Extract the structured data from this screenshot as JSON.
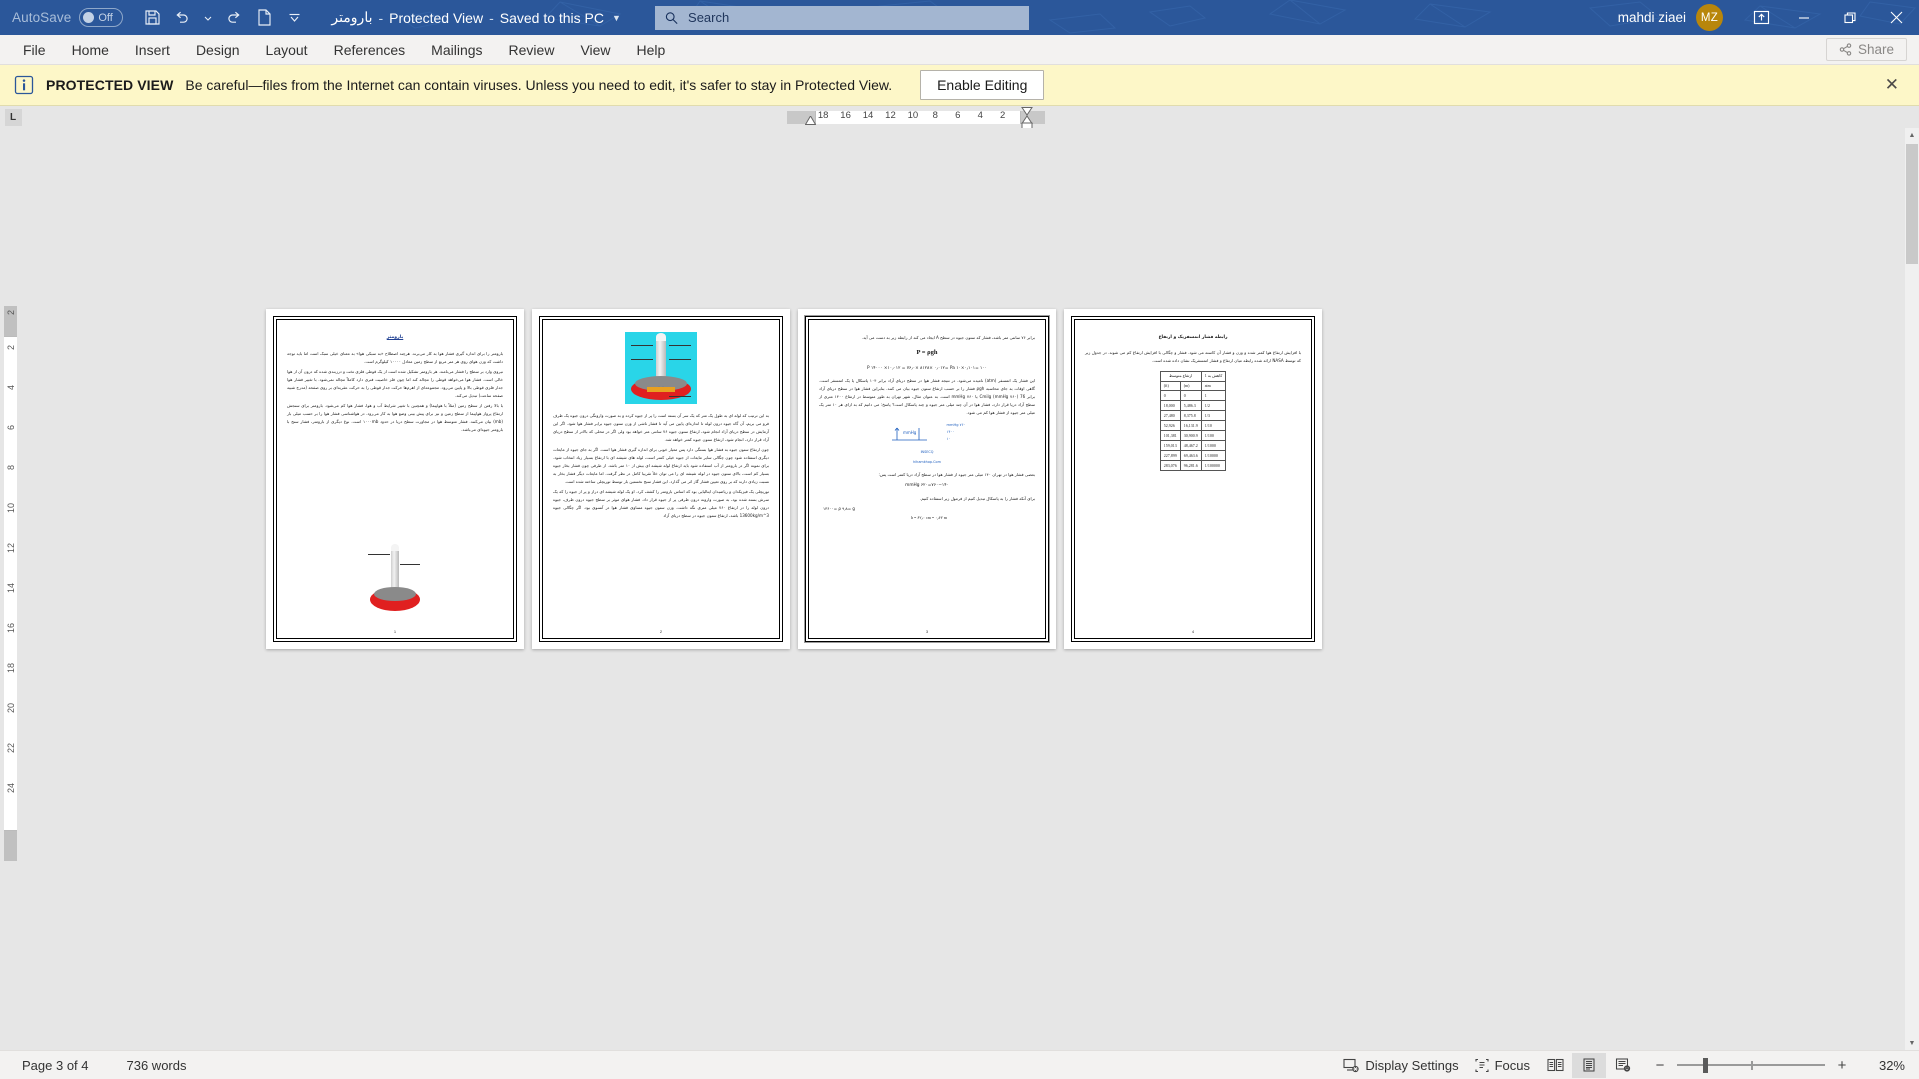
{
  "titlebar": {
    "autosave_label": "AutoSave",
    "autosave_state": "Off",
    "doc_title": "بارومتر",
    "sep1": "-",
    "protected_view": "Protected View",
    "sep2": "-",
    "saved_state": "Saved to this PC",
    "save_icon": "save-icon",
    "undo_icon": "undo-icon",
    "redo_icon": "redo-icon",
    "new_icon": "new-document-icon",
    "customize_icon": "customize-quick-access-icon",
    "username": "mahdi ziaei",
    "avatar_initials": "MZ",
    "ribbon_display_icon": "ribbon-display-options-icon",
    "minimize_icon": "minimize-icon",
    "restore_icon": "restore-icon",
    "close_icon": "close-icon",
    "accent_color": "#2b579a",
    "avatar_color": "#b8860b"
  },
  "search": {
    "placeholder": "Search",
    "value": "",
    "icon": "search-icon"
  },
  "menubar": {
    "items": [
      {
        "label": "File"
      },
      {
        "label": "Home"
      },
      {
        "label": "Insert"
      },
      {
        "label": "Design"
      },
      {
        "label": "Layout"
      },
      {
        "label": "References"
      },
      {
        "label": "Mailings"
      },
      {
        "label": "Review"
      },
      {
        "label": "View"
      },
      {
        "label": "Help"
      }
    ],
    "share_label": "Share",
    "share_icon": "share-icon"
  },
  "protected_view": {
    "icon": "info-icon",
    "strong": "PROTECTED VIEW",
    "message": "Be careful—files from the Internet can contain viruses. Unless you need to edit, it's safer to stay in Protected View.",
    "enable_button": "Enable Editing",
    "close_icon": "close-icon",
    "background": "#fdf7c8"
  },
  "rulers": {
    "tab_selector": "L",
    "horizontal_marks": [
      "18",
      "16",
      "14",
      "12",
      "10",
      "8",
      "6",
      "4",
      "2"
    ],
    "vertical_marks": [
      "2",
      "2",
      "4",
      "6",
      "8",
      "10",
      "12",
      "14",
      "16",
      "18",
      "20",
      "22",
      "24"
    ]
  },
  "document": {
    "pages": [
      {
        "number": "1",
        "heading": "بارومتر",
        "paragraphs": [
          "بارومتر را برای اندازه گیری فشار هوا به کار می‌برند. هرچند اصطلاح «به سبکی هوا» به معنای خیلی سبک است اما باید توجه داشت که وزن هوای روی هر متر مربع از سطح زمین معادل ۱۰۰۰۰ کیلوگرم است.",
          "نیروی وارد بر سطح را فشار می‌نامند. هر بارومتر تشکیل شده است از یک قوطی فلزی تخت و درزبندی شده که درون آن از هوا خالی است. فشار هوا می‌خواهد قوطی را مچاله کند اما چون فلز خاصیت فنری دارد کاملاً مچاله نمی‌شود. با تغییر فشار هوا جدار فلزی قوطی بالا و پایین می‌رود. مجموعه‌ای از اهرم‌ها حرکت جدار قوطی را به حرکت عقربه‌ای بر روی صفحه (مدرج شبیه صفحه ساعت) تبدیل می‌کند.",
          "با بالا رفتن از سطح زمین (مثلاً با هواپیما) و همچنین با تغییر شرایط آب و هوا، فشار هوا کم می‌شود. بارومتر برای سنجش ارتفاع پرواز هواپیما از سطح زمین و نیز برای پیش بینی وضع هوا به کار می‌رود. در هواشناسی فشار هوا را بر حسب میلی بار (mb) بیان می‌کنند. فشار متوسط هوا در مجاورت سطح دریا در حدود ۱۰۰۰mb است. نوع دیگری از بارومتر، فشار سنج با بارومتر جیوه‌ای می‌باشد."
        ],
        "has_figure": true
      },
      {
        "number": "2",
        "heading": "",
        "paragraphs": [
          "به این ترتیب که لوله ای به طول یک متر که یک سر آن بسته است را پر از جیوه کرده و به صورت وارونگی درون جیوه یک ظرف فرو می بریم، آن گاه جیوه درون لوله تا اندازه‌ای پایین می آید تا فشار ناشی از وزن ستون جیوه برابر فشار هوا شود. اگر این آزمایش در سطح دریای آزاد انجام شود، ارتفاع ستون جیوه ۷۶ سانتی متر خواهد بود ولی اگر در محلی که بالاتر از سطح دریای آزاد قرار دارد، انجام شود، ارتفاع ستون جیوه کمتر خواهد شد.",
          "چون ارتفاع ستون جیوه به فشار هوا بستگی دارد پس معیار خوبی برای اندازه گیری فشار هوا است. اگر به جای جیوه از مایعات دیگری استفاده شود چون چگالی سایر مایعات از جیوه خیلی کمتر است، لوله های شیشه ای با ارتفاع بسیار زیاد انتخاب شود. برای نمونه اگر در بارومتر از آب استفاده شود باید ارتفاع لوله شیشه ای بیش از ۱۰ متر باشد. از طرفی چون فشار بخار جیوه بسیار کم است، بالای ستون جیوه در لوله شیشه ای را می توان خلأ تقریبا کامل در نظر گرفت. اما مایعات دیگر فشار بخار به نسبت زیادی دارند که بر روی تعیین فشار گاز اثر می گذارد. این فشار سنج نخستین بار توسط توریچلی ساخته شده است.",
          "توریچلی یک فیزیکدان و ریاضیدان ایتالیایی بود که اساس بارومتر را کشف کرد. او یک لوله شیشه ای دراز و پر از جیوه را که یک سرش بسته شده بود، به صورت وارونه درون ظرفی پر از جیوه قرار داد. فشار هوای موثر بر سطح جیوه درون ظرف، جیوه درون لوله را در ارتفاع ۷۶۰ میلی متری نگه داشت. وزن ستون جیوه مساوی فشار هوا در آنسوی بود. اگر چگالی جیوه 13600kg/m^3 باشد، ارتفاع ستون جیوه در سطح دریای آزاد"
        ],
        "has_figure": true
      },
      {
        "number": "3",
        "heading": "",
        "paragraphs": [
          "برابر ۷۶ سانتی متر باشد، فشار که ستون جیوه در سطح A ایجاد می کند از رابطه زیر به دست می آید."
        ],
        "formula": "P = ρgh",
        "equation1": "۱۰۰ =P ۱۴۰۰۰ ×۱۰٫۰۱۲ = ۷۶٫۰× ۸۱۲۸× ۰٫۰۱۲= Pa ۱۰×۰٫۱۰۱",
        "paragraphs2": [
          "این فشار یک اتمسفر (atm) نامیده می‌شود. در نتیجه فشار هوا در سطح دریای آزاد برابر ۱۰۴ پاسکال یا یک اتمسفر است. گاهی اوقات به جای محاسبه ρgh فشار را بر حسب ارتفاع ستون جیوه بیان می کنند. بنابراین فشار هوا در سطح دریای آزاد برابر 76 Cmilg (mmHg ۷۶۰) یا ۷۶۰ mmHg است. به عنوان مثال، شهر تهران به طور متوسط در ارتفاع ۱۴۰۰ متری از سطح آزاد دریا قرار دارد، فشار هوا در آن چند میلی متر جیوه و چند پاسکال است؟ پاسخ: می دانیم که به ازای هر ۱۰ متر یک میلی متر جیوه از فشار هوا کم می شود."
        ],
        "note1": "بعضی فشار هوا در تهران ۱۴۰ میلی متر جیوه از فشار هوا در سطح آزاد دریا کمتر است پس:",
        "eq2": "۷۶۰−۱۴۰=۶۲۰ mmHg",
        "note2": "برای آنکه فشار را به پاسکال تبدیل کنیم از فرمول زیر استفاده کنیم.",
        "eq3": "۱۳۶۰۰= ρ        ۹٫۸= g",
        "eq4": "h = ۶۲٫۰ cm = ۰٫۶۲ m",
        "links": [
          "INSECQ",
          "hihamkhop.Com"
        ]
      },
      {
        "number": "4",
        "heading": "رابطه فشار اتمسفریک و ارتفاع",
        "paragraphs": [
          "با افزایش ارتفاع هوا کمتر شده و وزن و فشار آن کاسته می شود. فشار و چگالی با افزایش ارتفاع کم می شوند. در جدول زیر که توسط NASA ارائه شده رابطه میان ارتفاع و فشار اتمسفریک نشان داده شده است."
        ],
        "table": {
          "header_right": "کاهش به 1",
          "header_center": "ارتفاع متوسط",
          "subheaders": [
            "atm",
            "(m)",
            "(ft)"
          ],
          "rows": [
            [
              "1",
              "0",
              "0"
            ],
            [
              "1/2",
              "5,486.3",
              "18,000"
            ],
            [
              "1/3",
              "8,375.8",
              "27,480"
            ],
            [
              "1/10",
              "16,131.9",
              "52,926"
            ],
            [
              "1/100",
              "30,900.9",
              "101,381"
            ],
            [
              "1/1000",
              "48,467.2",
              "159,013"
            ],
            [
              "1/10000",
              "69,463.6",
              "227,899"
            ],
            [
              "1/100000",
              "96,281.6",
              "283,076"
            ]
          ]
        }
      }
    ]
  },
  "statusbar": {
    "page_info": "Page 3 of 4",
    "word_count": "736 words",
    "display_settings": "Display Settings",
    "display_settings_icon": "display-settings-icon",
    "focus": "Focus",
    "focus_icon": "focus-icon",
    "read_mode_icon": "read-mode-icon",
    "print_layout_icon": "print-layout-icon",
    "web_layout_icon": "web-layout-icon",
    "zoom_out": "−",
    "zoom_in": "+",
    "zoom_level": "32%"
  }
}
